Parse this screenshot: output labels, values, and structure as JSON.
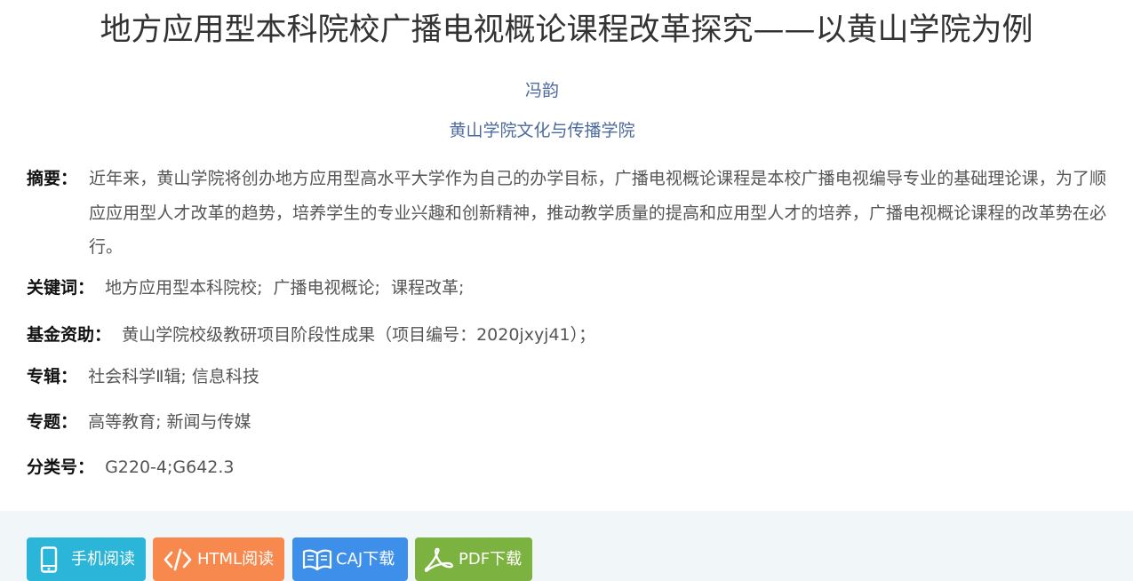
{
  "article": {
    "title": "地方应用型本科院校广播电视概论课程改革探究——以黄山学院为例",
    "author": "冯韵",
    "affiliation": "黄山学院文化与传播学院"
  },
  "fields": {
    "abstract_label": "摘要：",
    "abstract_text": "近年来，黄山学院将创办地方应用型高水平大学作为自己的办学目标，广播电视概论课程是本校广播电视编导专业的基础理论课，为了顺应应用型人才改革的趋势，培养学生的专业兴趣和创新精神，推动教学质量的提高和应用型人才的培养，广播电视概论课程的改革势在必行。",
    "keywords_label": "关键词：",
    "keywords": [
      "地方应用型本科院校;",
      "广播电视概论;",
      "课程改革;"
    ],
    "fund_label": "基金资助：",
    "fund_text": "黄山学院校级教研项目阶段性成果（项目编号：2020jxyj41）；",
    "series_label": "专辑：",
    "series_text": "社会科学Ⅱ辑; 信息科技",
    "topic_label": "专题：",
    "topic_text": "高等教育; 新闻与传媒",
    "classification_label": "分类号：",
    "classification_text": "G220-4;G642.3"
  },
  "actions": {
    "mobile_read": "手机阅读",
    "html_read": "HTML阅读",
    "caj_download": "CAJ下载",
    "pdf_download": "PDF下载"
  },
  "icons": {
    "mobile": "phone-icon",
    "html": "code-icon",
    "caj": "book-icon",
    "pdf": "acrobat-icon"
  },
  "colors": {
    "author_link": "#4d6a9d",
    "mobile_button": "#2bb5d8",
    "html_button": "#f7894e",
    "caj_button": "#3d8fea",
    "pdf_button": "#7cb23f",
    "footer_bg": "#f1f6f8"
  }
}
